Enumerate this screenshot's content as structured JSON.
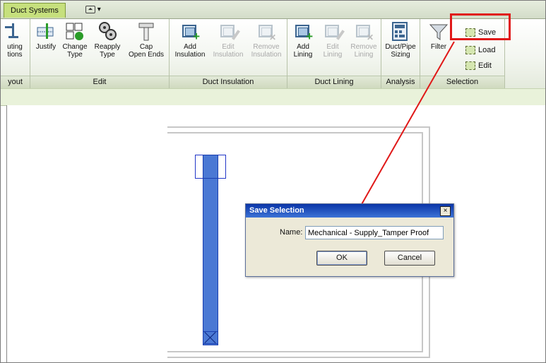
{
  "ribbon_tabs": {
    "active": "Duct Systems"
  },
  "panels": {
    "layout": {
      "title": "yout",
      "tools": [
        {
          "label1": "uting",
          "label2": "tions"
        }
      ]
    },
    "edit": {
      "title": "Edit",
      "tools": [
        {
          "label1": "Justify",
          "label2": ""
        },
        {
          "label1": "Change",
          "label2": "Type"
        },
        {
          "label1": "Reapply",
          "label2": "Type"
        },
        {
          "label1": "Cap",
          "label2": "Open Ends"
        }
      ]
    },
    "duct_insulation": {
      "title": "Duct Insulation",
      "tools": [
        {
          "label1": "Add",
          "label2": "Insulation"
        },
        {
          "label1": "Edit",
          "label2": "Insulation"
        },
        {
          "label1": "Remove",
          "label2": "Insulation"
        }
      ]
    },
    "duct_lining": {
      "title": "Duct Lining",
      "tools": [
        {
          "label1": "Add",
          "label2": "Lining"
        },
        {
          "label1": "Edit",
          "label2": "Lining"
        },
        {
          "label1": "Remove",
          "label2": "Lining"
        }
      ]
    },
    "analysis": {
      "title": "Analysis",
      "tools": [
        {
          "label1": "Duct/Pipe",
          "label2": "Sizing"
        }
      ]
    },
    "selection": {
      "title": "Selection",
      "filter_label": "Filter",
      "save_label": "Save",
      "load_label": "Load",
      "edit_label": "Edit"
    }
  },
  "dialog": {
    "title": "Save Selection",
    "close_glyph": "×",
    "name_label": "Name:",
    "name_value": "Mechanical - Supply_Tamper Proof",
    "ok_label": "OK",
    "cancel_label": "Cancel"
  },
  "colors": {
    "annotation_red": "#e01818",
    "duct_blue": "#4a78d4",
    "tab_green": "#c6e07d",
    "dialog_title_blue": "#0a35a8"
  },
  "icons": {
    "qat": "dropdown-box-icon",
    "layout": "routing-solutions-icon",
    "justify": "justify-icon",
    "change_type": "change-type-icon",
    "reapply_type": "reapply-type-icon",
    "cap": "cap-open-ends-icon",
    "add_insulation": "add-insulation-icon",
    "edit_insulation": "edit-insulation-icon",
    "remove_insulation": "remove-insulation-icon",
    "add_lining": "add-lining-icon",
    "edit_lining": "edit-lining-icon",
    "remove_lining": "remove-lining-icon",
    "sizing": "duct-pipe-sizing-icon",
    "filter": "filter-funnel-icon",
    "save": "save-selection-icon",
    "load": "load-selection-icon",
    "edit_selection": "edit-selection-icon"
  }
}
